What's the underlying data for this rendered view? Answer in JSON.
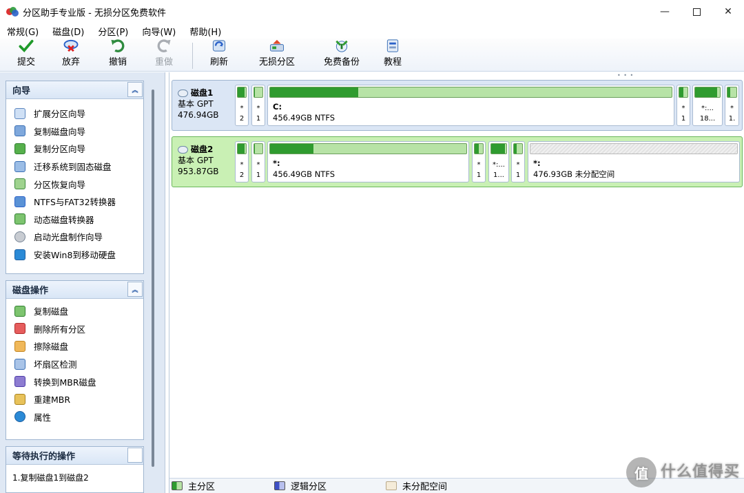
{
  "window": {
    "title": "分区助手专业版 - 无损分区免费软件"
  },
  "menu": [
    "常规(G)",
    "磁盘(D)",
    "分区(P)",
    "向导(W)",
    "帮助(H)"
  ],
  "toolbar": {
    "commit": "提交",
    "discard": "放弃",
    "undo": "撤销",
    "redo": "重做",
    "refresh": "刷新",
    "lossless": "无损分区",
    "backup": "免费备份",
    "tutorial": "教程"
  },
  "wizard": {
    "title": "向导",
    "items": [
      "扩展分区向导",
      "复制磁盘向导",
      "复制分区向导",
      "迁移系统到固态磁盘",
      "分区恢复向导",
      "NTFS与FAT32转换器",
      "动态磁盘转换器",
      "启动光盘制作向导",
      "安装Win8到移动硬盘"
    ]
  },
  "disk_ops": {
    "title": "磁盘操作",
    "items": [
      "复制磁盘",
      "删除所有分区",
      "擦除磁盘",
      "坏扇区检测",
      "转换到MBR磁盘",
      "重建MBR",
      "属性"
    ]
  },
  "pending": {
    "title": "等待执行的操作",
    "items": [
      "1.复制磁盘1到磁盘2"
    ]
  },
  "disks": [
    {
      "name": "磁盘1",
      "type": "基本 GPT",
      "size": "476.94GB",
      "parts": [
        {
          "top": "*",
          "bottom": "2",
          "fill": 0.85
        },
        {
          "top": "*",
          "bottom": "1",
          "fill": 0.1
        },
        {
          "top": "C:",
          "bottom": "456.49GB NTFS",
          "fill": 0.22
        },
        {
          "top": "*",
          "bottom": "1",
          "fill": 0.5
        },
        {
          "top": "*:...",
          "bottom": "18...",
          "fill": 0.9
        },
        {
          "top": "*",
          "bottom": "1.",
          "fill": 0.3
        }
      ]
    },
    {
      "name": "磁盘2",
      "type": "基本 GPT",
      "size": "953.87GB",
      "parts": [
        {
          "top": "*",
          "bottom": "2",
          "fill": 0.85
        },
        {
          "top": "*",
          "bottom": "1",
          "fill": 0.1
        },
        {
          "top": "*:",
          "bottom": "456.49GB NTFS",
          "fill": 0.22
        },
        {
          "top": "*",
          "bottom": "1",
          "fill": 0.5
        },
        {
          "top": "*:...",
          "bottom": "1...",
          "fill": 0.9
        },
        {
          "top": "*",
          "bottom": "1",
          "fill": 0.3
        },
        {
          "top": "*:",
          "bottom": "476.93GB 未分配空间",
          "fill": 0
        }
      ]
    }
  ],
  "legend": {
    "primary": "主分区",
    "logical": "逻辑分区",
    "unallocated": "未分配空间"
  },
  "colors": {
    "primary": "#2f9b2f",
    "logical": "#3d4fc4",
    "unallocated": "#f5ecd9",
    "selected_disk": "#c9f0b4"
  },
  "watermark": {
    "circle": "值",
    "text": "什么值得买"
  }
}
